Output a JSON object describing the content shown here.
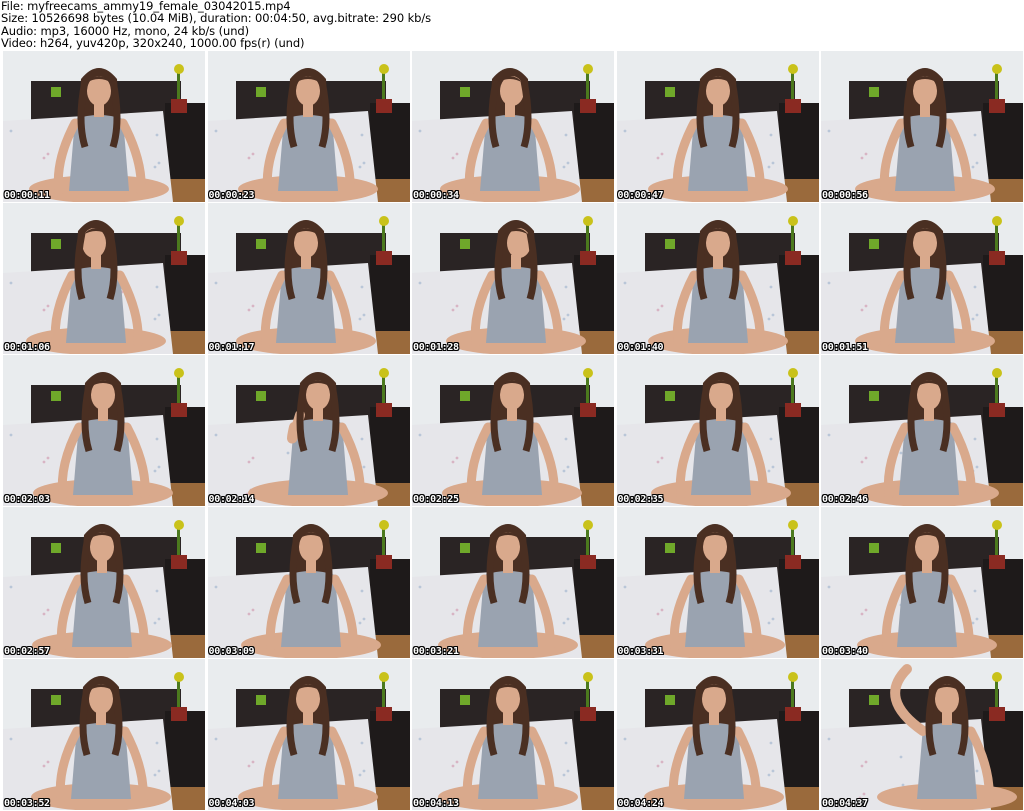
{
  "header": {
    "file": "File: myfreecams_ammy19_female_03042015.mp4",
    "size": "Size: 10526698 bytes (10.04 MiB), duration: 00:04:50, avg.bitrate: 290 kb/s",
    "audio": "Audio: mp3, 16000 Hz, mono, 24 kb/s (und)",
    "video": "Video: h264, yuv420p, 320x240, 1000.00 fps(r) (und)"
  },
  "thumbnails": [
    {
      "timestamp": "00:00:11"
    },
    {
      "timestamp": "00:00:23"
    },
    {
      "timestamp": "00:00:34"
    },
    {
      "timestamp": "00:00:47"
    },
    {
      "timestamp": "00:00:56"
    },
    {
      "timestamp": "00:01:06"
    },
    {
      "timestamp": "00:01:17"
    },
    {
      "timestamp": "00:01:28"
    },
    {
      "timestamp": "00:01:40"
    },
    {
      "timestamp": "00:01:51"
    },
    {
      "timestamp": "00:02:03"
    },
    {
      "timestamp": "00:02:14"
    },
    {
      "timestamp": "00:02:25"
    },
    {
      "timestamp": "00:02:35"
    },
    {
      "timestamp": "00:02:46"
    },
    {
      "timestamp": "00:02:57"
    },
    {
      "timestamp": "00:03:09"
    },
    {
      "timestamp": "00:03:21"
    },
    {
      "timestamp": "00:03:31"
    },
    {
      "timestamp": "00:03:40"
    },
    {
      "timestamp": "00:03:52"
    },
    {
      "timestamp": "00:04:03"
    },
    {
      "timestamp": "00:04:13"
    },
    {
      "timestamp": "00:04:24"
    },
    {
      "timestamp": "00:04:37"
    }
  ],
  "colors": {
    "wall": "#e9ecee",
    "headboard": "#2a2424",
    "bedsheet": "#e6e6ea",
    "floor": "#9a6a3c",
    "skin": "#d9a98c",
    "hair": "#4a2f22",
    "tanktop": "#9aa3b0",
    "plant": "#6fa82a",
    "redbox": "#8a2a22"
  }
}
